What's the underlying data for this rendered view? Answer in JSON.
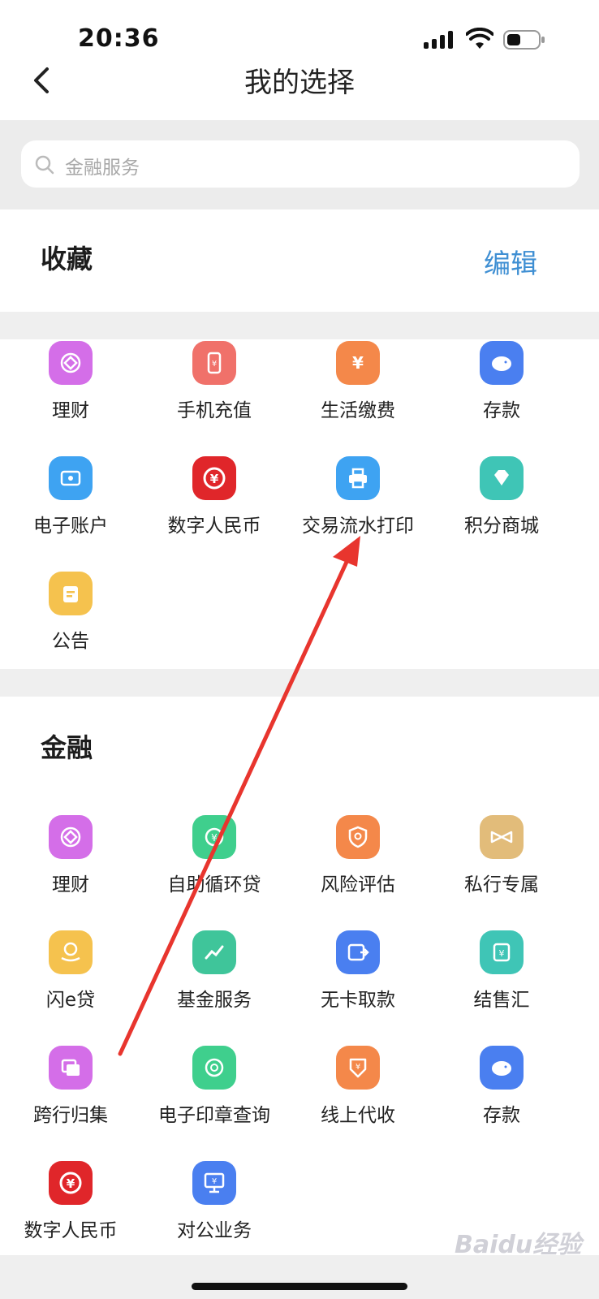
{
  "status": {
    "time": "20:36"
  },
  "nav": {
    "title": "我的选择"
  },
  "search": {
    "placeholder": "金融服务"
  },
  "favorites": {
    "title": "收藏",
    "edit_label": "编辑",
    "items": [
      {
        "label": "理财",
        "icon": "wealth-icon",
        "color": "#d46ee8"
      },
      {
        "label": "手机充值",
        "icon": "phone-recharge-icon",
        "color": "#f0716a"
      },
      {
        "label": "生活缴费",
        "icon": "utility-payment-icon",
        "color": "#f4884a"
      },
      {
        "label": "存款",
        "icon": "piggy-bank-icon",
        "color": "#4a7ff0"
      },
      {
        "label": "电子账户",
        "icon": "e-account-icon",
        "color": "#3ea3f2"
      },
      {
        "label": "数字人民币",
        "icon": "digital-rmb-icon",
        "color": "#e0262a"
      },
      {
        "label": "交易流水打印",
        "icon": "printer-icon",
        "color": "#3ea3f2"
      },
      {
        "label": "积分商城",
        "icon": "diamond-icon",
        "color": "#3fc5b6"
      },
      {
        "label": "公告",
        "icon": "notice-icon",
        "color": "#f5c24e"
      }
    ]
  },
  "finance": {
    "title": "金融",
    "items": [
      {
        "label": "理财",
        "icon": "wealth-icon",
        "color": "#d46ee8"
      },
      {
        "label": "自助循环贷",
        "icon": "revolving-loan-icon",
        "color": "#3fcf8d"
      },
      {
        "label": "风险评估",
        "icon": "risk-shield-icon",
        "color": "#f4884a"
      },
      {
        "label": "私行专属",
        "icon": "private-bank-icon",
        "color": "#e2bc7a"
      },
      {
        "label": "闪e贷",
        "icon": "e-loan-icon",
        "color": "#f5c24e"
      },
      {
        "label": "基金服务",
        "icon": "fund-chart-icon",
        "color": "#3fc59a"
      },
      {
        "label": "无卡取款",
        "icon": "cardless-withdraw-icon",
        "color": "#4a7ff0"
      },
      {
        "label": "结售汇",
        "icon": "exchange-icon",
        "color": "#3fc5b6"
      },
      {
        "label": "跨行归集",
        "icon": "cross-bank-icon",
        "color": "#d46ee8"
      },
      {
        "label": "电子印章查询",
        "icon": "e-seal-icon",
        "color": "#3fcf8d"
      },
      {
        "label": "线上代收",
        "icon": "online-collect-icon",
        "color": "#f4884a"
      },
      {
        "label": "存款",
        "icon": "piggy-bank-icon",
        "color": "#4a7ff0"
      },
      {
        "label": "数字人民币",
        "icon": "digital-rmb-icon",
        "color": "#e0262a"
      },
      {
        "label": "对公业务",
        "icon": "corporate-icon",
        "color": "#4a7ff0"
      }
    ]
  },
  "watermark": "Baidu经验"
}
